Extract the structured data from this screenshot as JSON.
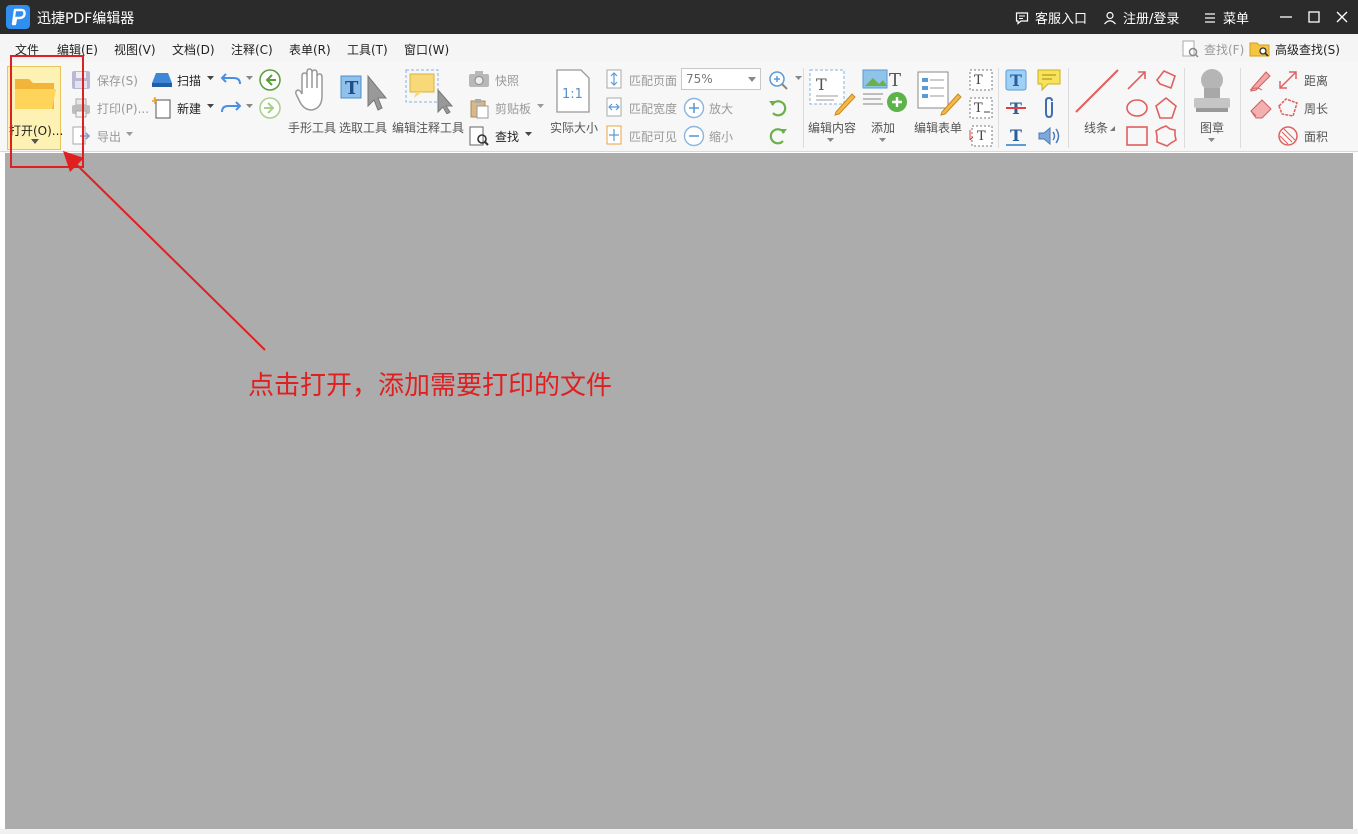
{
  "titlebar": {
    "title": "迅捷PDF编辑器",
    "support": "客服入口",
    "account": "注册/登录",
    "menu": "菜单",
    "brand_color": "#2f8ef0"
  },
  "menubar": {
    "items": [
      "文件",
      "编辑(E)",
      "视图(V)",
      "文档(D)",
      "注释(C)",
      "表单(R)",
      "工具(T)",
      "窗口(W)"
    ],
    "find": "查找(F)",
    "advanced_find": "高级查找(S)"
  },
  "toolbar": {
    "open": "打开(O)...",
    "save": "保存(S)",
    "print": "打印(P)...",
    "export": "导出",
    "scan": "扫描",
    "new": "新建",
    "hand_tool": "手形工具",
    "select_tool": "选取工具",
    "edit_annotation_tool": "编辑注释工具",
    "snapshot": "快照",
    "clipboard": "剪贴板",
    "find": "查找",
    "actual_size": "实际大小",
    "fit_page": "匹配页面",
    "fit_width": "匹配宽度",
    "fit_visible": "匹配可见",
    "zoom_value": "75%",
    "zoom_in": "放大",
    "zoom_out": "缩小",
    "edit_content": "编辑内容",
    "add": "添加",
    "edit_form": "编辑表单",
    "line": "线条",
    "stamp": "图章",
    "distance": "距离",
    "perimeter": "周长",
    "area": "面积",
    "actual_size_glyph": "1:1"
  },
  "annotation": {
    "text": "点击打开，添加需要打印的文件",
    "color": "#e02020"
  },
  "workspace": {
    "background": "#acacac"
  }
}
